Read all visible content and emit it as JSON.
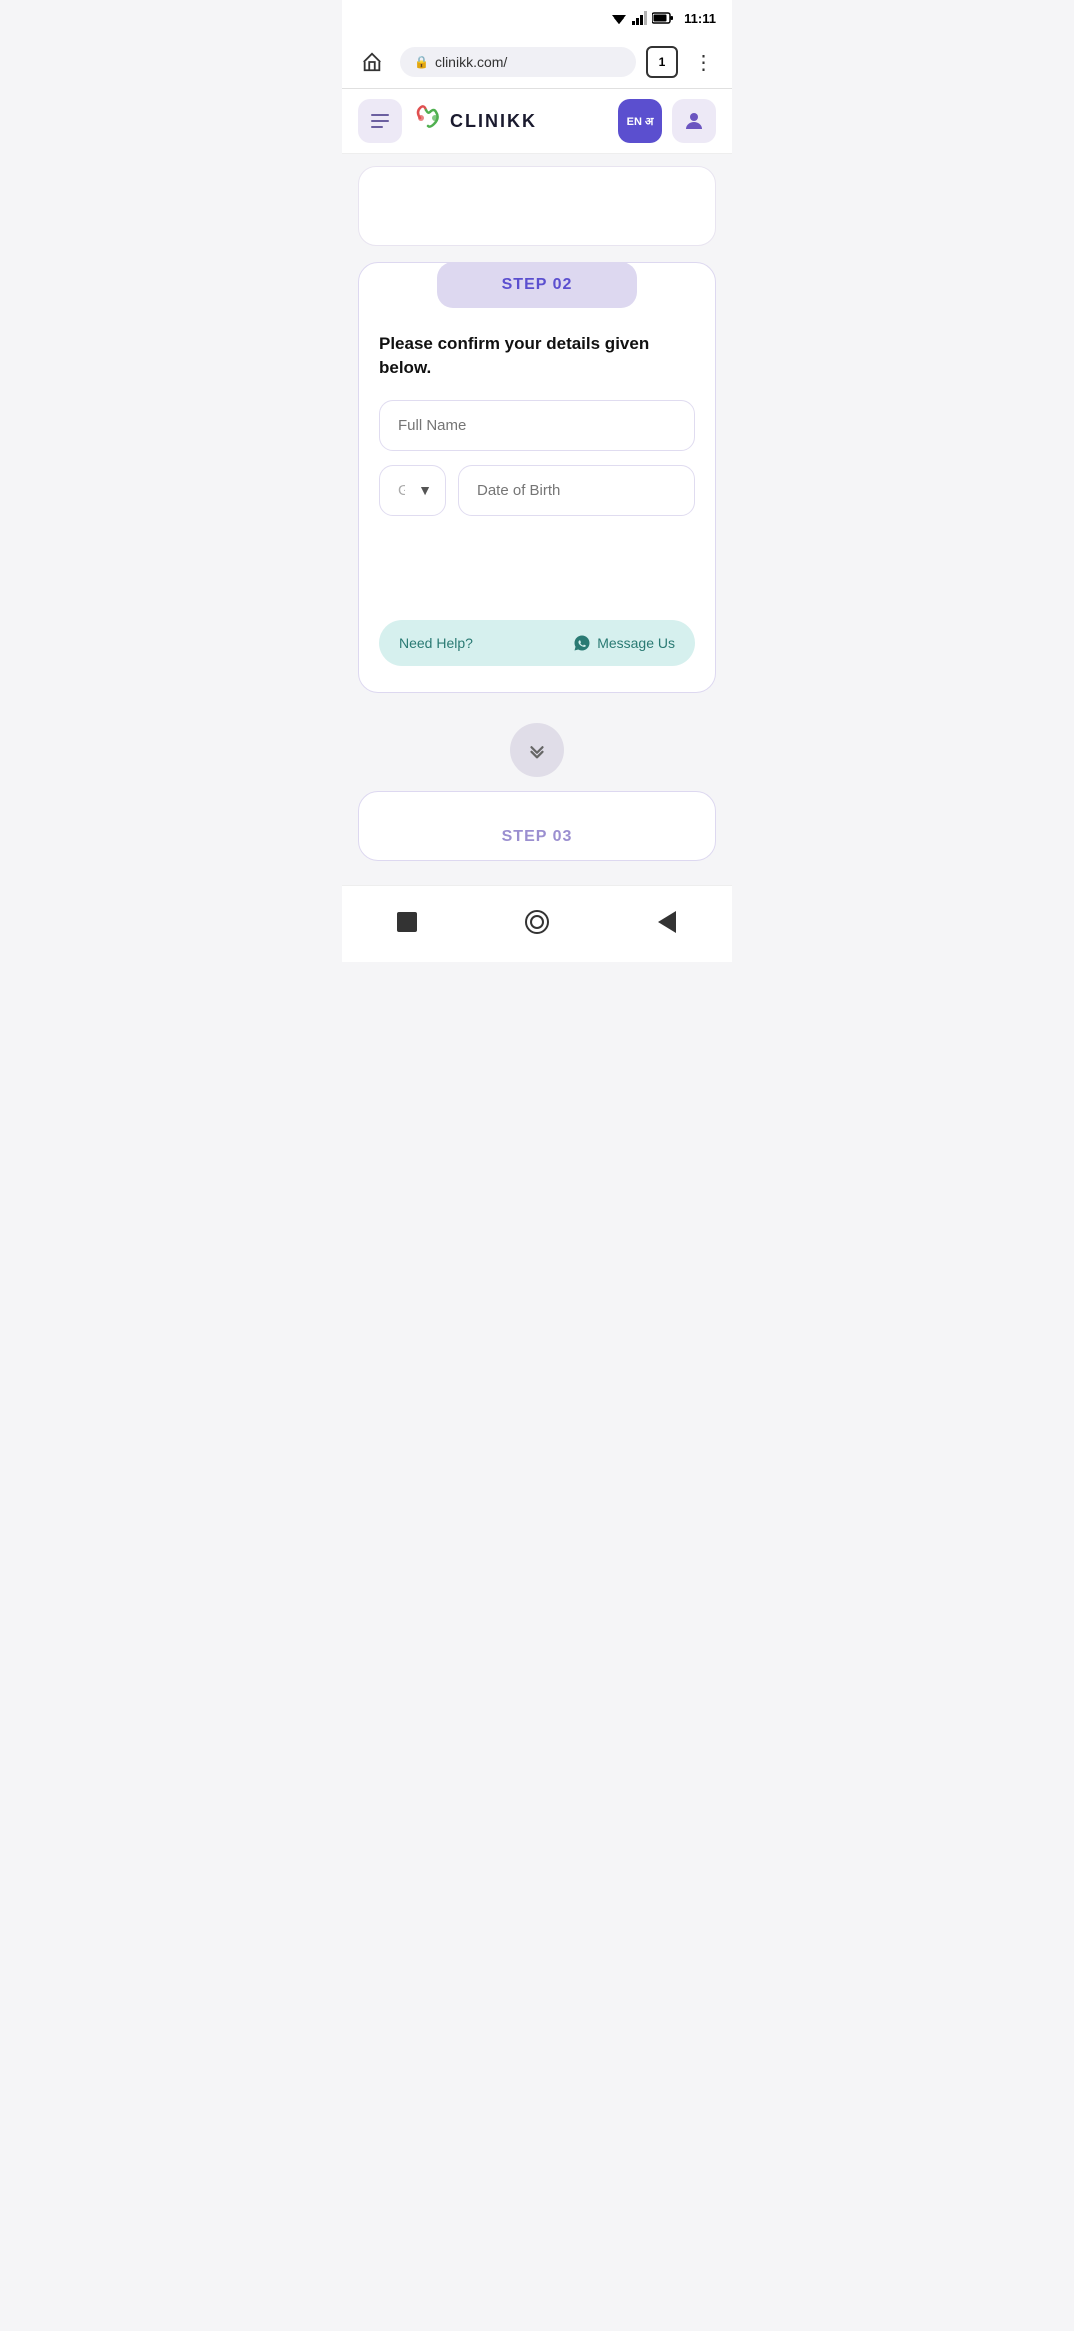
{
  "statusBar": {
    "time": "11:11"
  },
  "browserBar": {
    "url": "clinikk.com/",
    "tabCount": "1"
  },
  "navbar": {
    "logoText": "CLINIKK",
    "langLabel": "EN अ"
  },
  "step02": {
    "stepLabel": "STEP 02",
    "confirmText": "Please confirm your details given below.",
    "fullNamePlaceholder": "Full Name",
    "genderPlaceholder": "Gender",
    "dobPlaceholder": "Date of Birth"
  },
  "helpBar": {
    "needHelpText": "Need Help?",
    "messageUsText": "Message Us"
  },
  "step03": {
    "stepLabel": "STEP 03"
  },
  "bottomNav": {
    "squareLabel": "square",
    "circleLabel": "home",
    "backLabel": "back"
  }
}
